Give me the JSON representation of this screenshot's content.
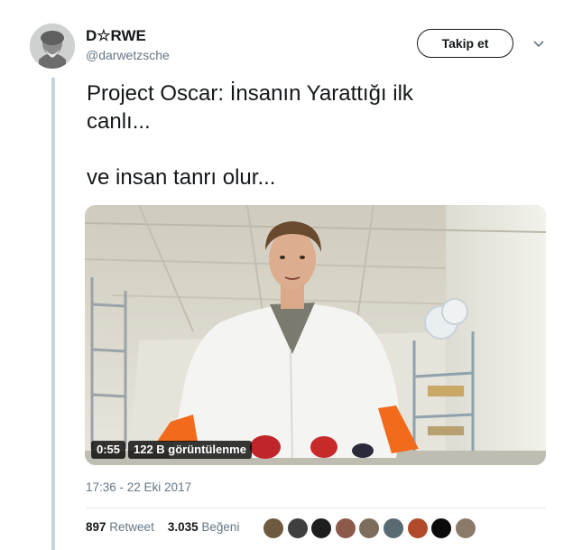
{
  "author": {
    "display_name": "D☆RWE",
    "handle": "@darwetzsche",
    "follow_label": "Takip et"
  },
  "tweet": {
    "line1": "Project Oscar: İnsanın Yarattığı ilk",
    "line2": "canlı...",
    "line3": "ve insan tanrı olur..."
  },
  "video": {
    "duration": "0:55",
    "views": "122 B görüntülenme"
  },
  "meta": {
    "timestamp": "17:36 - 22 Eki 2017"
  },
  "stats": {
    "retweet_count": "897",
    "retweet_label": "Retweet",
    "like_count": "3.035",
    "like_label": "Beğeni"
  },
  "liker_colors": [
    "#6e5a3e",
    "#3f3f3f",
    "#1e1e1e",
    "#8c5a4a",
    "#7c6d5d",
    "#5a6a72",
    "#b04a2a",
    "#0b0b0b",
    "#8a7a6a"
  ],
  "colors": {
    "text": "#14171a",
    "secondary": "#657786",
    "divider": "#e6ecf0"
  },
  "icons": {
    "caret": "chevron-down-icon"
  }
}
